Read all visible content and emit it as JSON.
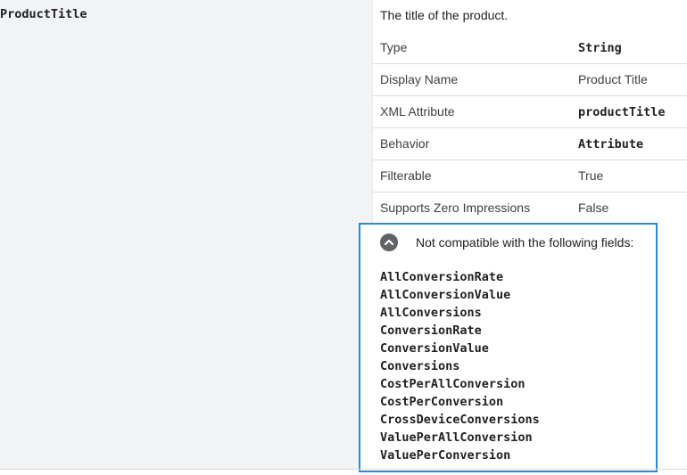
{
  "field": {
    "name": "ProductTitle",
    "description": "The title of the product."
  },
  "properties": [
    {
      "label": "Type",
      "value": "String"
    },
    {
      "label": "Display Name",
      "value": "Product Title"
    },
    {
      "label": "XML Attribute",
      "value": "productTitle"
    },
    {
      "label": "Behavior",
      "value": "Attribute"
    },
    {
      "label": "Filterable",
      "value": "True"
    },
    {
      "label": "Supports Zero Impressions",
      "value": "False"
    }
  ],
  "compatibility": {
    "toggle_icon": "chevron-up-icon",
    "header": "Not compatible with the following fields:",
    "fields": [
      "AllConversionRate",
      "AllConversionValue",
      "AllConversions",
      "ConversionRate",
      "ConversionValue",
      "Conversions",
      "CostPerAllConversion",
      "CostPerConversion",
      "CrossDeviceConversions",
      "ValuePerAllConversion",
      "ValuePerConversion"
    ]
  },
  "colors": {
    "highlight_border": "#1a8ee8",
    "left_background": "#f1f3f4",
    "toggle_background": "#5f6368"
  }
}
